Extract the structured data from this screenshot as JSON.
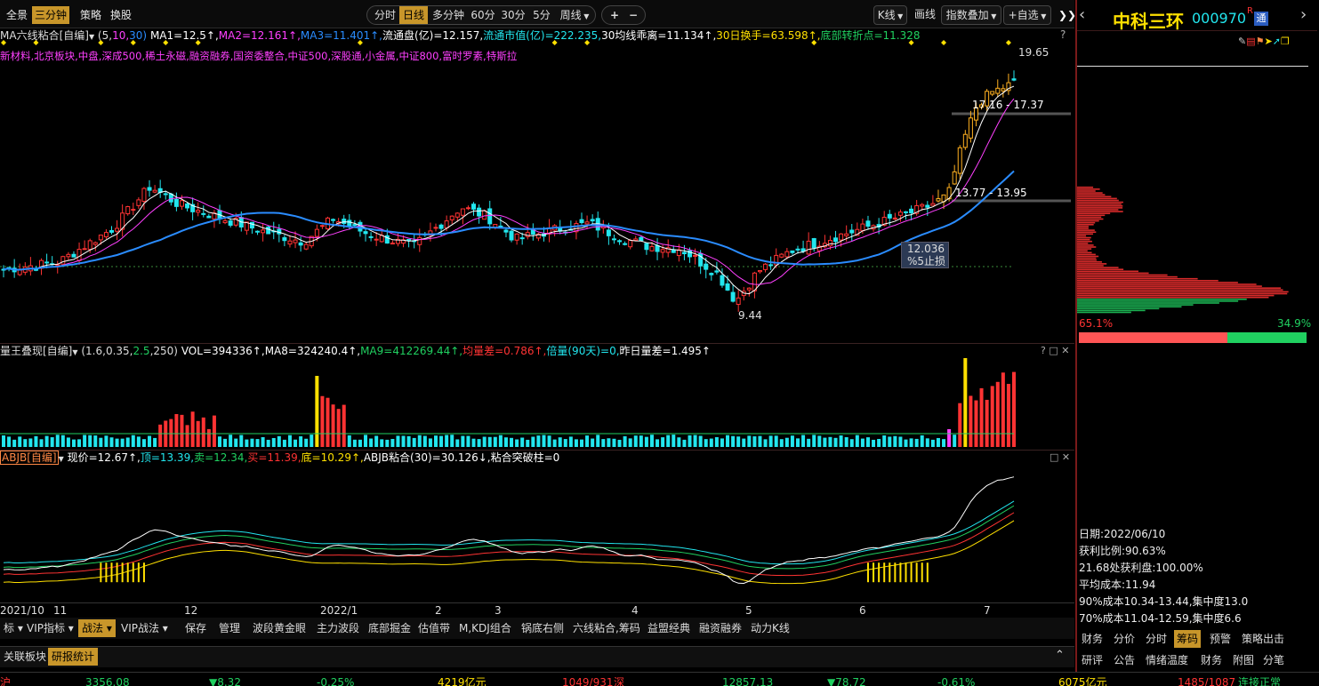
{
  "topbar": {
    "left_tabs": [
      "全景",
      "三分钟",
      "策略",
      "换股"
    ],
    "active_left": "三分钟",
    "periods": [
      "分时",
      "日线",
      "多分钟",
      "60分",
      "30分",
      "5分",
      "周线"
    ],
    "active_period": "日线",
    "plus": "+",
    "minus": "−",
    "kline": "K线",
    "draw": "画线",
    "overlay": "指数叠加",
    "watchlist": "+自选",
    "collapse": "❯❯"
  },
  "main_panel": {
    "indicator_name": "MA六线粘合[自编]",
    "params_open": "(5,",
    "param1": "10,",
    "param2": "30)",
    "ma1": "MA1=12.5↑,",
    "ma2": "MA2=12.161↑,",
    "ma3": "MA3=11.401↑,",
    "float_cap": "流通盘(亿)=12.157,",
    "float_mv": "流通市值(亿)=222.235,",
    "deviation": "30均线乖离=11.134↑,",
    "turnover": "30日换手=63.598↑,",
    "bottom_turn": "底部转折点=11.328",
    "concepts": "新材料,北京板块,中盘,深成500,稀土永磁,融资融券,国资委整合,中证500,深股通,小金属,中证800,富时罗素,特斯拉",
    "high_label": "19.65",
    "range1": "17.16 - 17.37",
    "range2": "13.77 - 13.95",
    "stop_price": "12.036",
    "stop_label": "%5止损",
    "low_label": "9.44",
    "help": "?"
  },
  "vol_panel": {
    "name": "量王叠现[自编]",
    "params": "(1.6,0.35,",
    "params_b": "2.5",
    "params_c": ",250)",
    "vol": "VOL=394336↑,",
    "ma8": "MA8=324240.4↑,",
    "ma9": "MA9=412269.44↑,",
    "avg_diff": "均量差=0.786↑,",
    "times_vol": "倍量(90天)=0,",
    "prev_diff": "昨日量差=1.495↑",
    "controls": "? □ ✕"
  },
  "abjb_panel": {
    "name": "ABJB[自编]",
    "price": "现价=12.67↑,",
    "top": "顶=13.39,",
    "sell": "卖=12.34,",
    "buy": "买=11.39,",
    "bottom": "底=10.29↑,",
    "abjb": "ABJB粘合(30)=30.126↓,",
    "breakout": "粘合突破柱=0",
    "controls": "□ ✕"
  },
  "x_axis": [
    "2021/10",
    "11",
    "12",
    "2022/1",
    "2",
    "3",
    "4",
    "5",
    "6",
    "7"
  ],
  "bottom_tabs": [
    "标 ▾",
    "VIP指标 ▾",
    "战法 ▾",
    "VIP战法 ▾",
    "保存",
    "管理",
    "波段黄金眼",
    "主力波段",
    "底部掘金",
    "估值带",
    "M,KDJ组合",
    "锅底右侧",
    "六线粘合,筹码",
    "益盟经典",
    "融资融券",
    "动力K线"
  ],
  "active_bottom_tab": "战法 ▾",
  "sub_tabs": [
    "关联板块",
    "研报统计"
  ],
  "active_sub_tab": "研报统计",
  "ticker": {
    "i1": "3356.08",
    "i1c": "▼8.32",
    "i1p": "-0.25%",
    "i1v": "4219亿元",
    "i1n": "1049/931",
    "sz": "深",
    "i2": "12857.13",
    "i2c": "▼78.72",
    "i2p": "-0.61%",
    "i2v": "6075亿元",
    "i2n": "1485/1087",
    "status": "连接正常"
  },
  "right_panel": {
    "name": "中科三环",
    "code": "000970",
    "badge_r": "R",
    "badge_t": "通",
    "left_pct": "65.1%",
    "right_pct": "34.9%",
    "date": "日期:2022/06/10",
    "profit_ratio": "获利比例:90.63%",
    "profit_at": "21.68处获利盘:100.00%",
    "avg_cost": "平均成本:11.94",
    "cost90": "90%成本10.34-13.44,集中度13.0",
    "cost70": "70%成本11.04-12.59,集中度6.6",
    "tabs1": [
      "财务",
      "分价",
      "分时",
      "筹码",
      "预警",
      "策略出击"
    ],
    "active_tab1": "筹码",
    "tabs2": [
      "研评",
      "公告",
      "情绪温度",
      "财务",
      "附图",
      "分笔"
    ],
    "colors": {
      "red": "#ff3333",
      "cyan": "#22e6ee",
      "green": "#20d060",
      "yellow": "#ffe000",
      "magenta": "#ff40ff",
      "blue": "#2a8cff",
      "gold": "#c8962a"
    }
  }
}
